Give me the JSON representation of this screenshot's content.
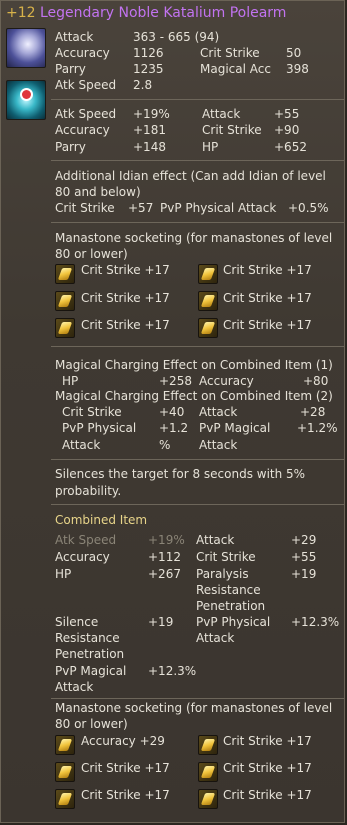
{
  "title": {
    "enchant": "+12",
    "name": "Legendary Noble Katalium Polearm"
  },
  "icons": {
    "weapon": "polearm-icon",
    "skin": "appearance-icon"
  },
  "base_stats": [
    {
      "label": "Attack",
      "value": "363 - 665 (94)"
    },
    {
      "label": "Accuracy",
      "value": "1126"
    },
    {
      "label": "Parry",
      "value": "1235"
    },
    {
      "label": "Atk Speed",
      "value": "2.8"
    },
    {
      "label": "Crit Strike",
      "value": "50"
    },
    {
      "label": "Magical Acc",
      "value": "398"
    }
  ],
  "enchant_stats": [
    {
      "label": "Atk Speed",
      "value": "+19%"
    },
    {
      "label": "Accuracy",
      "value": "+181"
    },
    {
      "label": "Parry",
      "value": "+148"
    },
    {
      "label": "Attack",
      "value": "+55"
    },
    {
      "label": "Crit Strike",
      "value": "+90"
    },
    {
      "label": "HP",
      "value": "+652"
    }
  ],
  "idian": {
    "heading_line1": "Additional Idian effect (Can add Idian of level",
    "heading_line2": "80 and below)",
    "stats": [
      {
        "label": "Crit Strike",
        "value": "+57"
      },
      {
        "label": "PvP Physical Attack",
        "value": "+0.5%"
      }
    ]
  },
  "manastones": {
    "heading_line1": "Manastone socketing (for manastones of level",
    "heading_line2": "80 or lower)",
    "slots": [
      "Crit Strike +17",
      "Crit Strike +17",
      "Crit Strike +17",
      "Crit Strike +17",
      "Crit Strike +17",
      "Crit Strike +17"
    ]
  },
  "charging": {
    "heading1": "Magical Charging Effect on Combined Item (1)",
    "stats1": [
      {
        "label": "HP",
        "value": "+258"
      },
      {
        "label": "Accuracy",
        "value": "+80"
      }
    ],
    "heading2": "Magical Charging Effect on Combined Item (2)",
    "stats2": [
      {
        "label": "Crit Strike",
        "value": "+40"
      },
      {
        "label": "Attack",
        "value": "+28"
      },
      {
        "label_line1": "PvP Physical",
        "label_line2": "Attack",
        "value_line1": "+1.2",
        "value_line2": "%"
      },
      {
        "label_line1": "PvP Magical",
        "label_line2": "Attack",
        "value": "+1.2%"
      }
    ]
  },
  "silence_effect": {
    "line1": "Silences the target for 8 seconds with 5%",
    "line2": "probability."
  },
  "combined": {
    "heading": "Combined Item",
    "stats": [
      {
        "label": "Atk Speed",
        "value": "+19%"
      },
      {
        "label": "Accuracy",
        "value": "+112"
      },
      {
        "label": "HP",
        "value": "+267"
      },
      {
        "label": "Attack",
        "value": "+29"
      },
      {
        "label": "Crit Strike",
        "value": "+55"
      },
      {
        "label_line1": "Paralysis",
        "label_line2": "Resistance",
        "label_line3": "Penetration",
        "value": "+19"
      },
      {
        "label_line1": "Silence",
        "label_line2": "Resistance",
        "label_line3": "Penetration",
        "value": "+19"
      },
      {
        "label_line1": "PvP Physical",
        "label_line2": "Attack",
        "value": "+12.3%"
      },
      {
        "label_line1": "PvP Magical",
        "label_line2": "Attack",
        "value": "+12.3%"
      }
    ],
    "manastones": {
      "heading_line1": "Manastone socketing (for manastones of level",
      "heading_line2": "80 or lower)",
      "slots": [
        "Accuracy +29",
        "Crit Strike +17",
        "Crit Strike +17",
        "Crit Strike +17",
        "Crit Strike +17",
        "Crit Strike +17"
      ]
    }
  },
  "colors": {
    "title_name": "#c273f0",
    "enchant": "#d8b24a",
    "highlight_heading": "#e8d58a",
    "dim_text": "#8a8477"
  }
}
